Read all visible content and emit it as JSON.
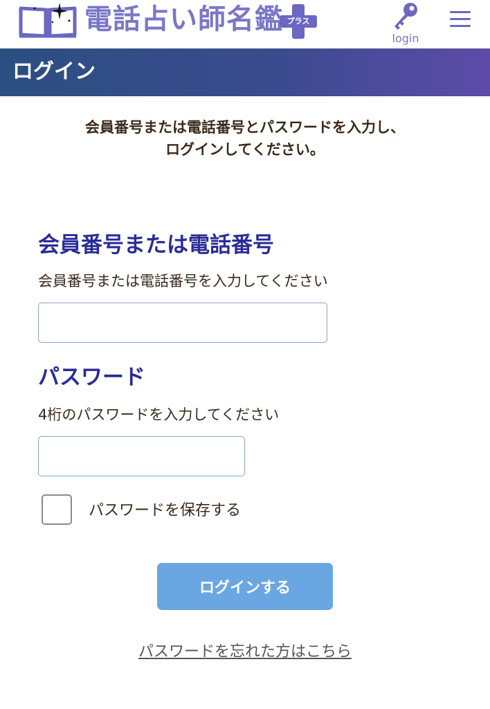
{
  "header": {
    "logo_text": "電話占い師名鑑",
    "logo_badge": "プラス",
    "login_label": "login",
    "icons": {
      "logo": "open-book-star-icon",
      "login": "key-icon",
      "menu": "hamburger-menu-icon"
    }
  },
  "banner": {
    "title": "ログイン"
  },
  "intro": {
    "line1": "会員番号または電話番号とパスワードを入力し、",
    "line2": "ログインしてください。"
  },
  "member_field": {
    "title": "会員番号または電話番号",
    "hint": "会員番号または電話番号を入力してください",
    "value": ""
  },
  "password_field": {
    "title": "パスワード",
    "hint": "4桁のパスワードを入力してください",
    "value": ""
  },
  "save_password": {
    "label": "パスワードを保存する",
    "checked": false
  },
  "submit": {
    "label": "ログインする"
  },
  "forgot_link": {
    "label": "パスワードを忘れた方はこちら"
  },
  "colors": {
    "accent": "#2a2c98",
    "logo": "#7a76c8",
    "button": "#6aa6e2",
    "banner_start": "#2b4f80",
    "banner_end": "#5d4ba8"
  }
}
